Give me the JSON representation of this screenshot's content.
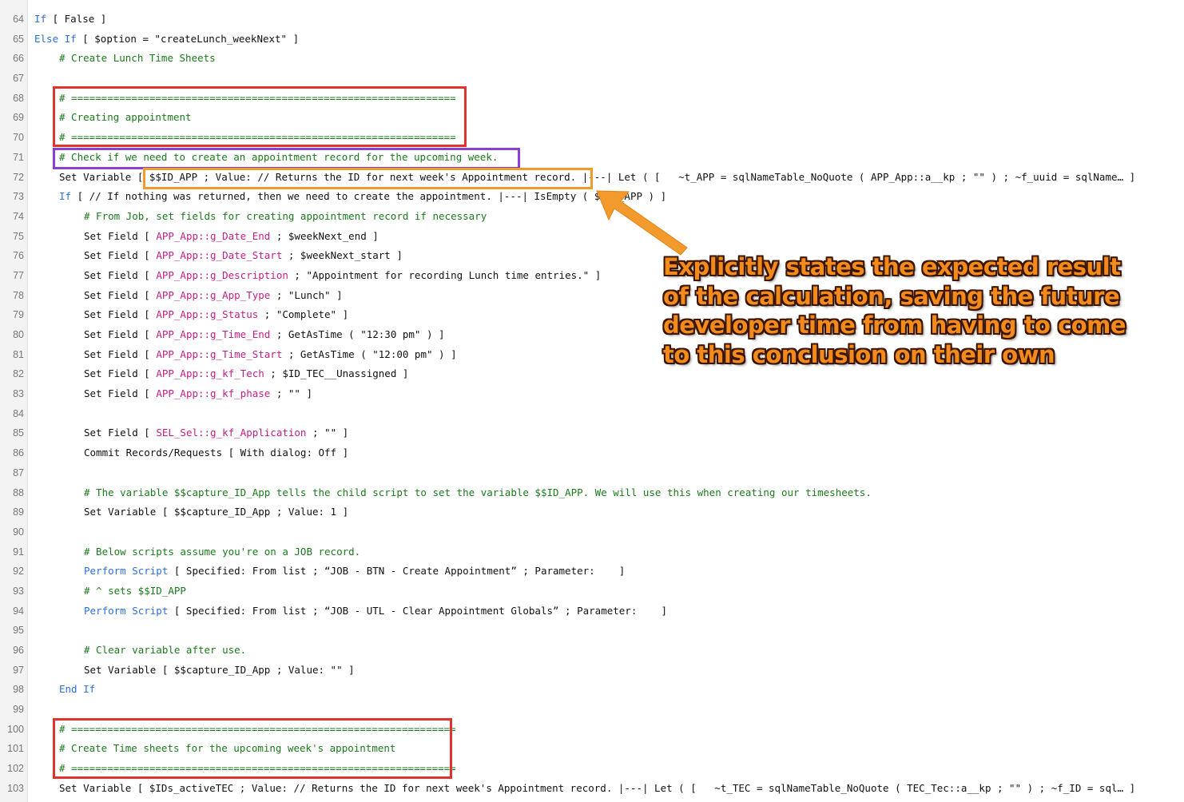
{
  "editor": {
    "lines": [
      {
        "n": "64",
        "indent": 0,
        "tokens": [
          {
            "t": "kw",
            "v": "If"
          },
          {
            "t": "plain",
            "v": " [ False ]"
          }
        ]
      },
      {
        "n": "65",
        "indent": 0,
        "tokens": [
          {
            "t": "kw",
            "v": "Else If"
          },
          {
            "t": "plain",
            "v": " [ $option = \"createLunch_weekNext\" ]"
          }
        ]
      },
      {
        "n": "66",
        "indent": 1,
        "tokens": [
          {
            "t": "cmt",
            "v": "# Create Lunch Time Sheets"
          }
        ]
      },
      {
        "n": "67",
        "indent": 0,
        "tokens": []
      },
      {
        "n": "68",
        "indent": 1,
        "tokens": [
          {
            "t": "cmt",
            "v": "# ================================================================"
          }
        ]
      },
      {
        "n": "69",
        "indent": 1,
        "tokens": [
          {
            "t": "cmt",
            "v": "# Creating appointment"
          }
        ]
      },
      {
        "n": "70",
        "indent": 1,
        "tokens": [
          {
            "t": "cmt",
            "v": "# ================================================================"
          }
        ]
      },
      {
        "n": "71",
        "indent": 1,
        "tokens": [
          {
            "t": "cmt",
            "v": "# Check if we need to create an appointment record for the upcoming week."
          }
        ]
      },
      {
        "n": "72",
        "indent": 1,
        "tokens": [
          {
            "t": "plain",
            "v": "Set Variable [ $$ID_APP ; Value: // Returns the ID for next week's Appointment record. |---| Let ( [   ~t_APP = sqlNameTable_NoQuote ( APP_App::a__kp ; \"\" ) ; ~f_uuid = sqlName… ]"
          }
        ]
      },
      {
        "n": "73",
        "indent": 1,
        "tokens": [
          {
            "t": "kw",
            "v": "If"
          },
          {
            "t": "plain",
            "v": " [ // If nothing was returned, then we need to create the appointment. |---| IsEmpty ( $$ID_APP ) ]"
          }
        ]
      },
      {
        "n": "74",
        "indent": 2,
        "tokens": [
          {
            "t": "cmt",
            "v": "# From Job, set fields for creating appointment record if necessary"
          }
        ]
      },
      {
        "n": "75",
        "indent": 2,
        "tokens": [
          {
            "t": "plain",
            "v": "Set Field [ "
          },
          {
            "t": "fld",
            "v": "APP_App::g_Date_End"
          },
          {
            "t": "plain",
            "v": " ; $weekNext_end ]"
          }
        ]
      },
      {
        "n": "76",
        "indent": 2,
        "tokens": [
          {
            "t": "plain",
            "v": "Set Field [ "
          },
          {
            "t": "fld",
            "v": "APP_App::g_Date_Start"
          },
          {
            "t": "plain",
            "v": " ; $weekNext_start ]"
          }
        ]
      },
      {
        "n": "77",
        "indent": 2,
        "tokens": [
          {
            "t": "plain",
            "v": "Set Field [ "
          },
          {
            "t": "fld",
            "v": "APP_App::g_Description"
          },
          {
            "t": "plain",
            "v": " ; \"Appointment for recording Lunch time entries.\" ]"
          }
        ]
      },
      {
        "n": "78",
        "indent": 2,
        "tokens": [
          {
            "t": "plain",
            "v": "Set Field [ "
          },
          {
            "t": "fld",
            "v": "APP_App::g_App_Type"
          },
          {
            "t": "plain",
            "v": " ; \"Lunch\" ]"
          }
        ]
      },
      {
        "n": "79",
        "indent": 2,
        "tokens": [
          {
            "t": "plain",
            "v": "Set Field [ "
          },
          {
            "t": "fld",
            "v": "APP_App::g_Status"
          },
          {
            "t": "plain",
            "v": " ; \"Complete\" ]"
          }
        ]
      },
      {
        "n": "80",
        "indent": 2,
        "tokens": [
          {
            "t": "plain",
            "v": "Set Field [ "
          },
          {
            "t": "fld",
            "v": "APP_App::g_Time_End"
          },
          {
            "t": "plain",
            "v": " ; GetAsTime ( \"12:30 pm\" ) ]"
          }
        ]
      },
      {
        "n": "81",
        "indent": 2,
        "tokens": [
          {
            "t": "plain",
            "v": "Set Field [ "
          },
          {
            "t": "fld",
            "v": "APP_App::g_Time_Start"
          },
          {
            "t": "plain",
            "v": " ; GetAsTime ( \"12:00 pm\" ) ]"
          }
        ]
      },
      {
        "n": "82",
        "indent": 2,
        "tokens": [
          {
            "t": "plain",
            "v": "Set Field [ "
          },
          {
            "t": "fld",
            "v": "APP_App::g_kf_Tech"
          },
          {
            "t": "plain",
            "v": " ; $ID_TEC__Unassigned ]"
          }
        ]
      },
      {
        "n": "83",
        "indent": 2,
        "tokens": [
          {
            "t": "plain",
            "v": "Set Field [ "
          },
          {
            "t": "fld",
            "v": "APP_App::g_kf_phase"
          },
          {
            "t": "plain",
            "v": " ; \"\" ]"
          }
        ]
      },
      {
        "n": "84",
        "indent": 0,
        "tokens": []
      },
      {
        "n": "85",
        "indent": 2,
        "tokens": [
          {
            "t": "plain",
            "v": "Set Field [ "
          },
          {
            "t": "fld",
            "v": "SEL_Sel::g_kf_Application"
          },
          {
            "t": "plain",
            "v": " ; \"\" ]"
          }
        ]
      },
      {
        "n": "86",
        "indent": 2,
        "tokens": [
          {
            "t": "plain",
            "v": "Commit Records/Requests [ With dialog: Off ]"
          }
        ]
      },
      {
        "n": "87",
        "indent": 0,
        "tokens": []
      },
      {
        "n": "88",
        "indent": 2,
        "tokens": [
          {
            "t": "cmt",
            "v": "# The variable $$capture_ID_App tells the child script to set the variable $$ID_APP. We will use this when creating our timesheets."
          }
        ]
      },
      {
        "n": "89",
        "indent": 2,
        "tokens": [
          {
            "t": "plain",
            "v": "Set Variable [ $$capture_ID_App ; Value: 1 ]"
          }
        ]
      },
      {
        "n": "90",
        "indent": 0,
        "tokens": []
      },
      {
        "n": "91",
        "indent": 2,
        "tokens": [
          {
            "t": "cmt",
            "v": "# Below scripts assume you're on a JOB record."
          }
        ]
      },
      {
        "n": "92",
        "indent": 2,
        "tokens": [
          {
            "t": "kw",
            "v": "Perform Script"
          },
          {
            "t": "plain",
            "v": " [ Specified: From list ; “JOB - BTN - Create Appointment” ; Parameter:    ]"
          }
        ]
      },
      {
        "n": "93",
        "indent": 2,
        "tokens": [
          {
            "t": "cmt",
            "v": "# ^ sets $$ID_APP"
          }
        ]
      },
      {
        "n": "94",
        "indent": 2,
        "tokens": [
          {
            "t": "kw",
            "v": "Perform Script"
          },
          {
            "t": "plain",
            "v": " [ Specified: From list ; “JOB - UTL - Clear Appointment Globals” ; Parameter:    ]"
          }
        ]
      },
      {
        "n": "95",
        "indent": 0,
        "tokens": []
      },
      {
        "n": "96",
        "indent": 2,
        "tokens": [
          {
            "t": "cmt",
            "v": "# Clear variable after use."
          }
        ]
      },
      {
        "n": "97",
        "indent": 2,
        "tokens": [
          {
            "t": "plain",
            "v": "Set Variable [ $$capture_ID_App ; Value: \"\" ]"
          }
        ]
      },
      {
        "n": "98",
        "indent": 1,
        "tokens": [
          {
            "t": "kw",
            "v": "End If"
          }
        ]
      },
      {
        "n": "99",
        "indent": 0,
        "tokens": []
      },
      {
        "n": "100",
        "indent": 1,
        "tokens": [
          {
            "t": "cmt",
            "v": "# ================================================================"
          }
        ]
      },
      {
        "n": "101",
        "indent": 1,
        "tokens": [
          {
            "t": "cmt",
            "v": "# Create Time sheets for the upcoming week's appointment"
          }
        ]
      },
      {
        "n": "102",
        "indent": 1,
        "tokens": [
          {
            "t": "cmt",
            "v": "# ================================================================"
          }
        ]
      },
      {
        "n": "103",
        "indent": 1,
        "tokens": [
          {
            "t": "plain",
            "v": "Set Variable [ $IDs_activeTEC ; Value: // Returns the ID for next week's Appointment record. |---| Let ( [   ~t_TEC = sqlNameTable_NoQuote ( TEC_Tec::a__kp ; \"\" ) ; ~f_ID = sql… ]"
          }
        ]
      }
    ]
  },
  "annotation": {
    "callout_lines": [
      "Explicitly states the expected result",
      "of the calculation, saving the future",
      "developer time from having to come",
      "to this conclusion on their own"
    ],
    "colors": {
      "callout_fill": "#f28a1c",
      "callout_outline": "#3a1500",
      "arrow": "#f39a2c",
      "box_red": "#e0332b",
      "box_purple": "#8b3fd1",
      "box_orange": "#f39a2c"
    }
  },
  "colors": {
    "keyword": "#2d6fd8",
    "comment": "#1c7a1c",
    "field": "#c21f86",
    "text": "#111111",
    "line_number": "#777777"
  }
}
